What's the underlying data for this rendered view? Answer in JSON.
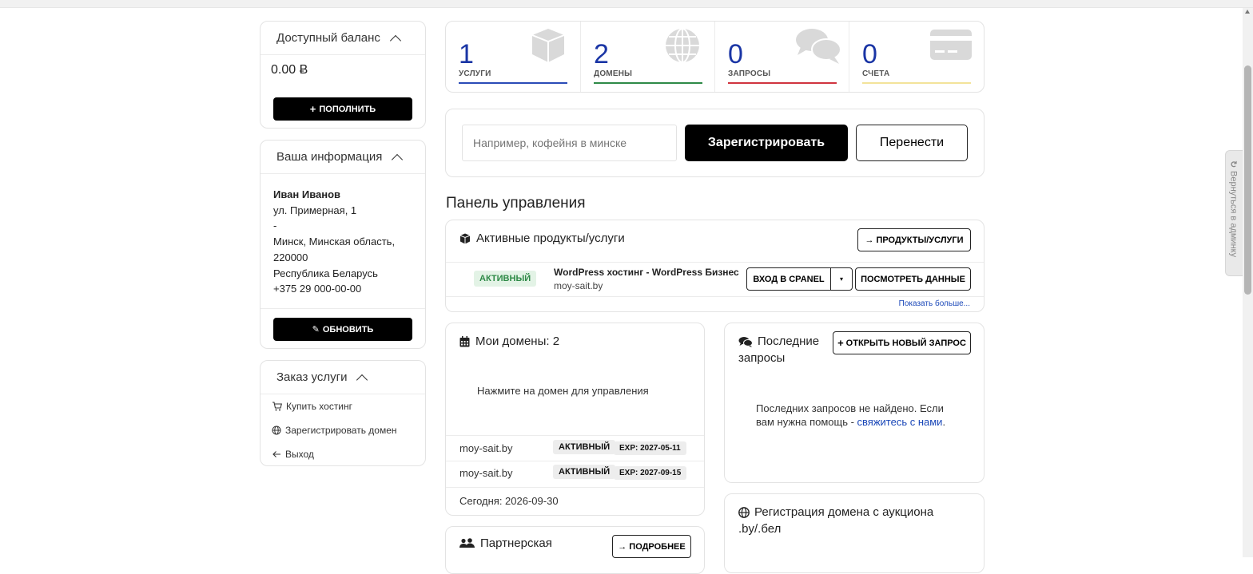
{
  "balance": {
    "title": "Доступный баланс",
    "amount": "0.00 Ƀ",
    "topup_label": "ПОПОЛНИТЬ"
  },
  "info": {
    "title": "Ваша информация",
    "name": "Иван Иванов",
    "address1": "ул. Примерная, 1",
    "address2": "-",
    "city": "Минск, Минская область,",
    "postcode": "220000",
    "country": "Республика Беларусь",
    "phone": "+375 29 000-00-00",
    "update_label": "ОБНОВИТЬ"
  },
  "order": {
    "title": "Заказ услуги",
    "items": [
      {
        "label": "Купить хостинг",
        "icon": "cart-icon"
      },
      {
        "label": "Зарегистрировать домен",
        "icon": "globe-icon"
      },
      {
        "label": "Выход",
        "icon": "arrow-left-icon"
      }
    ]
  },
  "stats": [
    {
      "value": "1",
      "label": "УСЛУГИ",
      "color": "#2a4bb7",
      "icon": "cube-icon"
    },
    {
      "value": "2",
      "label": "ДОМЕНЫ",
      "color": "#2e8a47",
      "icon": "globe-icon"
    },
    {
      "value": "0",
      "label": "ЗАПРОСЫ",
      "color": "#d0343f",
      "icon": "comments-icon"
    },
    {
      "value": "0",
      "label": "СЧЕТА",
      "color": "#f3e39a",
      "icon": "credit-card-icon"
    }
  ],
  "domain_search": {
    "placeholder": "Например, кофейня в минске",
    "register_label": "Зарегистрировать",
    "transfer_label": "Перенести"
  },
  "dashboard_title": "Панель управления",
  "products": {
    "title": "Активные продукты/услуги",
    "all_button": "ПРОДУКТЫ/УСЛУГИ",
    "row": {
      "status": "АКТИВНЫЙ",
      "name": "WordPress хостинг - WordPress Бизнес",
      "domain": "moy-sait.by",
      "cpanel_label": "ВХОД В CPANEL",
      "view_label": "ПОСМОТРЕТЬ ДАННЫЕ"
    },
    "show_more": "Показать больше..."
  },
  "domains": {
    "title": "Мои домены: 2",
    "hint": "Нажмите на домен для управления",
    "rows": [
      {
        "name": "moy-sait.by",
        "status": "АКТИВНЫЙ",
        "exp": "EXP: 2027-05-11"
      },
      {
        "name": "moy-sait.by",
        "status": "АКТИВНЫЙ",
        "exp": "EXP: 2027-09-15"
      }
    ],
    "today": "Сегодня: 2026-09-30"
  },
  "tickets": {
    "title_line1": "Последние",
    "title_line2": "запросы",
    "open_label": "ОТКРЫТЬ НОВЫЙ ЗАПРОС",
    "empty_text_1": "Последних запросов не найдено. Если",
    "empty_text_2": "вам нужна помощь - ",
    "contact_link": "свяжитесь с нами",
    "empty_text_end": "."
  },
  "auction": {
    "title_line1": "Регистрация домена с аукциона",
    "title_line2": ".by/.бел"
  },
  "affiliate": {
    "title": "Партнерская",
    "more_label": "ПОДРОБНЕЕ"
  },
  "side_tab": {
    "label": "Вернуться в админку"
  }
}
